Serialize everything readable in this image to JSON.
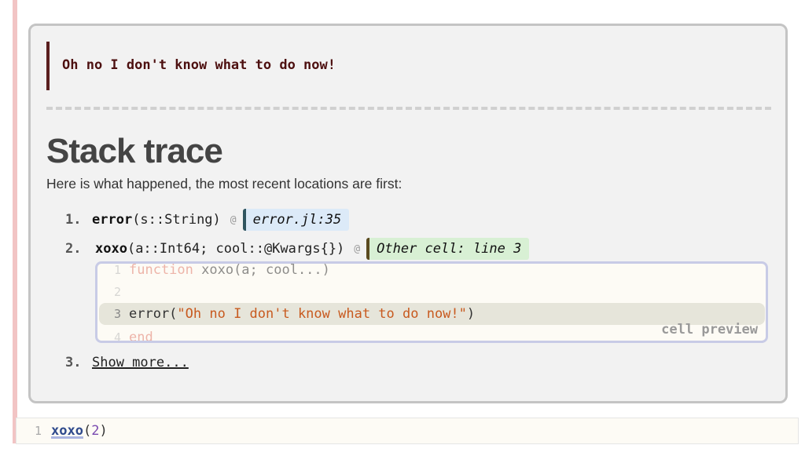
{
  "error": {
    "message": "Oh no I don't know what to do now!"
  },
  "stacktrace": {
    "title": "Stack trace",
    "description": "Here is what happened, the most recent locations are first:",
    "frames": [
      {
        "number": "1.",
        "function": "error",
        "signature": "(s::String)",
        "at": "@",
        "location": "error.jl:35"
      },
      {
        "number": "2.",
        "function": "xoxo",
        "signature": "(a::Int64; cool::@Kwargs{})",
        "at": "@",
        "location": "Other cell: line 3"
      }
    ],
    "show_more": {
      "number": "3.",
      "label": "Show more..."
    }
  },
  "cell_preview": {
    "label": "cell preview",
    "lines": [
      {
        "num": "1",
        "keyword": "function",
        "rest": " xoxo(a; cool...)"
      },
      {
        "num": "2",
        "text": ""
      },
      {
        "num": "3",
        "prefix": "error(",
        "string": "\"Oh no I don't know what to do now!\"",
        "suffix": ")"
      },
      {
        "num": "4",
        "keyword": "end"
      }
    ]
  },
  "code_cell": {
    "line_number": "1",
    "function": "xoxo",
    "open": "(",
    "arg": "2",
    "close": ")"
  },
  "colors": {
    "cell_bar": "#f2c4c4",
    "error_text": "#4d1010",
    "badge_blue": "#dceaf8",
    "badge_green": "#d8f0d4",
    "preview_border": "#c8cbe6"
  }
}
